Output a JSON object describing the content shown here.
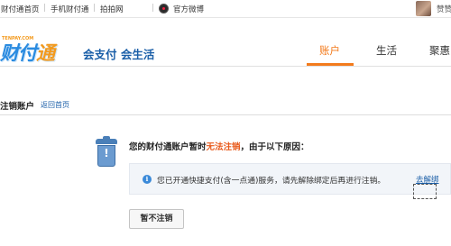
{
  "topbar": {
    "links": [
      "财付通首页",
      "手机财付通",
      "拍拍网"
    ],
    "weibo_label": "官方微博",
    "user_name": "赞赞"
  },
  "logo": {
    "small_text": "TENPAY.COM",
    "brand_a": "财付",
    "brand_b": "通",
    "slogan": "会支付 会生活"
  },
  "nav": {
    "tabs": [
      "账户",
      "生活",
      "聚惠"
    ],
    "active_tab": "账户"
  },
  "page": {
    "title": "注销账户",
    "back_link": "返回首页"
  },
  "notice": {
    "prefix": "您的财付通账户暂时",
    "highlight": "无法注销",
    "suffix": "，由于以下原因：",
    "info_text": "您已开通快捷支付(含一点通)服务，请先解除绑定后再进行注销。",
    "info_link": "去解绑",
    "button_label": "暂不注销"
  },
  "colors": {
    "accent_orange": "#f37b1d",
    "link_blue": "#1b5fa8",
    "warn_orange": "#e8591a",
    "info_bg": "#f2f5f9"
  },
  "icons": [
    "weibo-icon",
    "trash-icon",
    "info-icon"
  ]
}
